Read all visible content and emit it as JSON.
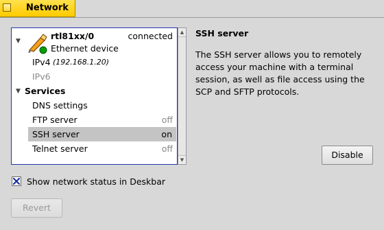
{
  "window": {
    "title": "Network"
  },
  "device": {
    "name": "rtl81xx/0",
    "status": "connected",
    "type": "Ethernet device",
    "ipv4_label": "IPv4",
    "ipv4_addr": "(192.168.1.20)",
    "ipv6_label": "IPv6"
  },
  "services": {
    "header": "Services",
    "items": [
      {
        "label": "DNS settings",
        "value": ""
      },
      {
        "label": "FTP server",
        "value": "off"
      },
      {
        "label": "SSH server",
        "value": "on"
      },
      {
        "label": "Telnet server",
        "value": "off"
      }
    ]
  },
  "detail": {
    "title": "SSH server",
    "description": "The SSH server allows you to remotely access your machine with a terminal session, as well as file access using the SCP and SFTP protocols.",
    "action_label": "Disable"
  },
  "options": {
    "deskbar_label": "Show network status in Deskbar",
    "deskbar_checked": true
  },
  "footer": {
    "revert_label": "Revert"
  },
  "colors": {
    "tab": "#ffcb00",
    "selection": "#c4c4c4",
    "list_border": "#2233aa",
    "status_led": "#00a000"
  }
}
